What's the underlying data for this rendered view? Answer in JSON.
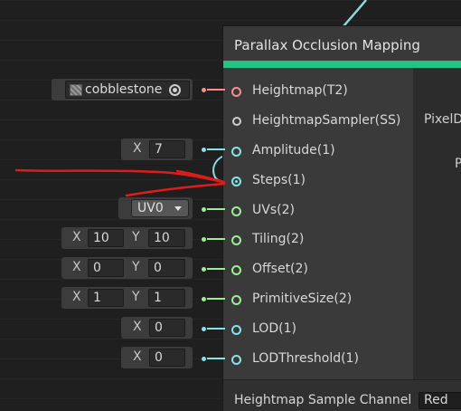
{
  "node": {
    "title": "Parallax Occlusion Mapping",
    "outputs": [
      "PixelD",
      "P"
    ],
    "footer_label": "Heightmap Sample Channel",
    "footer_value": "Red"
  },
  "ports": [
    {
      "label": "Heightmap(T2)",
      "kind": "tex"
    },
    {
      "label": "HeightmapSampler(SS)",
      "kind": "samp"
    },
    {
      "label": "Amplitude(1)",
      "kind": "float"
    },
    {
      "label": "Steps(1)",
      "kind": "float"
    },
    {
      "label": "UVs(2)",
      "kind": "vec2"
    },
    {
      "label": "Tiling(2)",
      "kind": "vec2"
    },
    {
      "label": "Offset(2)",
      "kind": "vec2"
    },
    {
      "label": "PrimitiveSize(2)",
      "kind": "vec2"
    },
    {
      "label": "LOD(1)",
      "kind": "float"
    },
    {
      "label": "LODThreshold(1)",
      "kind": "float"
    }
  ],
  "inputs": {
    "heightmap_texture": "cobblestone",
    "amplitude": {
      "x_label": "X",
      "x": "7"
    },
    "uvs": "UV0",
    "tiling": {
      "x_label": "X",
      "x": "10",
      "y_label": "Y",
      "y": "10"
    },
    "offset": {
      "x_label": "X",
      "x": "0",
      "y_label": "Y",
      "y": "0"
    },
    "primitive_size": {
      "x_label": "X",
      "x": "1",
      "y_label": "Y",
      "y": "1"
    },
    "lod": {
      "x_label": "X",
      "x": "0"
    },
    "lod_threshold": {
      "x_label": "X",
      "x": "0"
    }
  },
  "colors": {
    "accent": "#22c484",
    "texture_port": "#ff8b8b",
    "float_port": "#84e4e7",
    "vector2_port": "#9aef92",
    "annotation": "#e01b1b",
    "wire": "#8fd8dc"
  },
  "icons": {
    "texture_thumbnail": "texture-thumbnail-icon",
    "object_picker": "object-picker-icon",
    "dropdown": "caret-down-icon"
  }
}
